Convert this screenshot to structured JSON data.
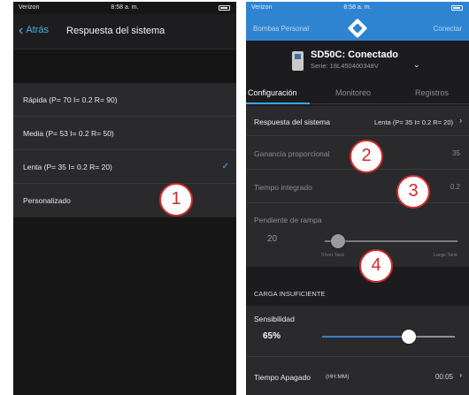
{
  "left": {
    "status": {
      "carrier": "Verizon",
      "time": "8:58 a. m."
    },
    "nav": {
      "back_label": "Atrás",
      "title": "Respuesta del sistema"
    },
    "options": [
      {
        "label": "Rápida (P= 70 I= 0.2 R= 90)",
        "checked": false
      },
      {
        "label": "Media (P= 53 I= 0.2 R= 50)",
        "checked": false
      },
      {
        "label": "Lenta (P= 35 I= 0.2 R= 20)",
        "checked": true
      },
      {
        "label": "Personalizado",
        "checked": false
      }
    ],
    "badge": "1"
  },
  "right": {
    "status": {
      "carrier": "Verizon",
      "time": "8:58 a. m."
    },
    "header": {
      "left": "Bombas Personal",
      "right": "Conectar"
    },
    "device": {
      "name": "SD50C: Conectado",
      "serial": "Serie: 18L450400348V"
    },
    "tabs": [
      "Configuración",
      "Monitoreo",
      "Registros"
    ],
    "active_tab": 0,
    "system_response": {
      "label": "Respuesta del sistema",
      "value": "Lenta (P= 35 I= 0.2 R= 20)"
    },
    "proportional_gain": {
      "label": "Ganancia proporcional",
      "value": "35"
    },
    "integral_time": {
      "label": "Tiempo integrado",
      "value": "0.2"
    },
    "ramp": {
      "label": "Pendiente de rampa",
      "value": "20",
      "min_label": "Short Tank",
      "max_label": "Large Tank",
      "level": 0.1
    },
    "section_title": "CARGA INSUFICIENTE",
    "sensitivity": {
      "label": "Sensibilidad",
      "value": "65%",
      "level": 0.65
    },
    "off_time": {
      "label": "Tiempo Apagado",
      "unit": "(HH:MM)",
      "value": "00:05"
    },
    "badges": [
      "2",
      "3",
      "4"
    ]
  },
  "colors": {
    "accent_blue": "#2f84d1",
    "link_blue": "#44b7e6",
    "badge_red": "#d22a2a"
  }
}
